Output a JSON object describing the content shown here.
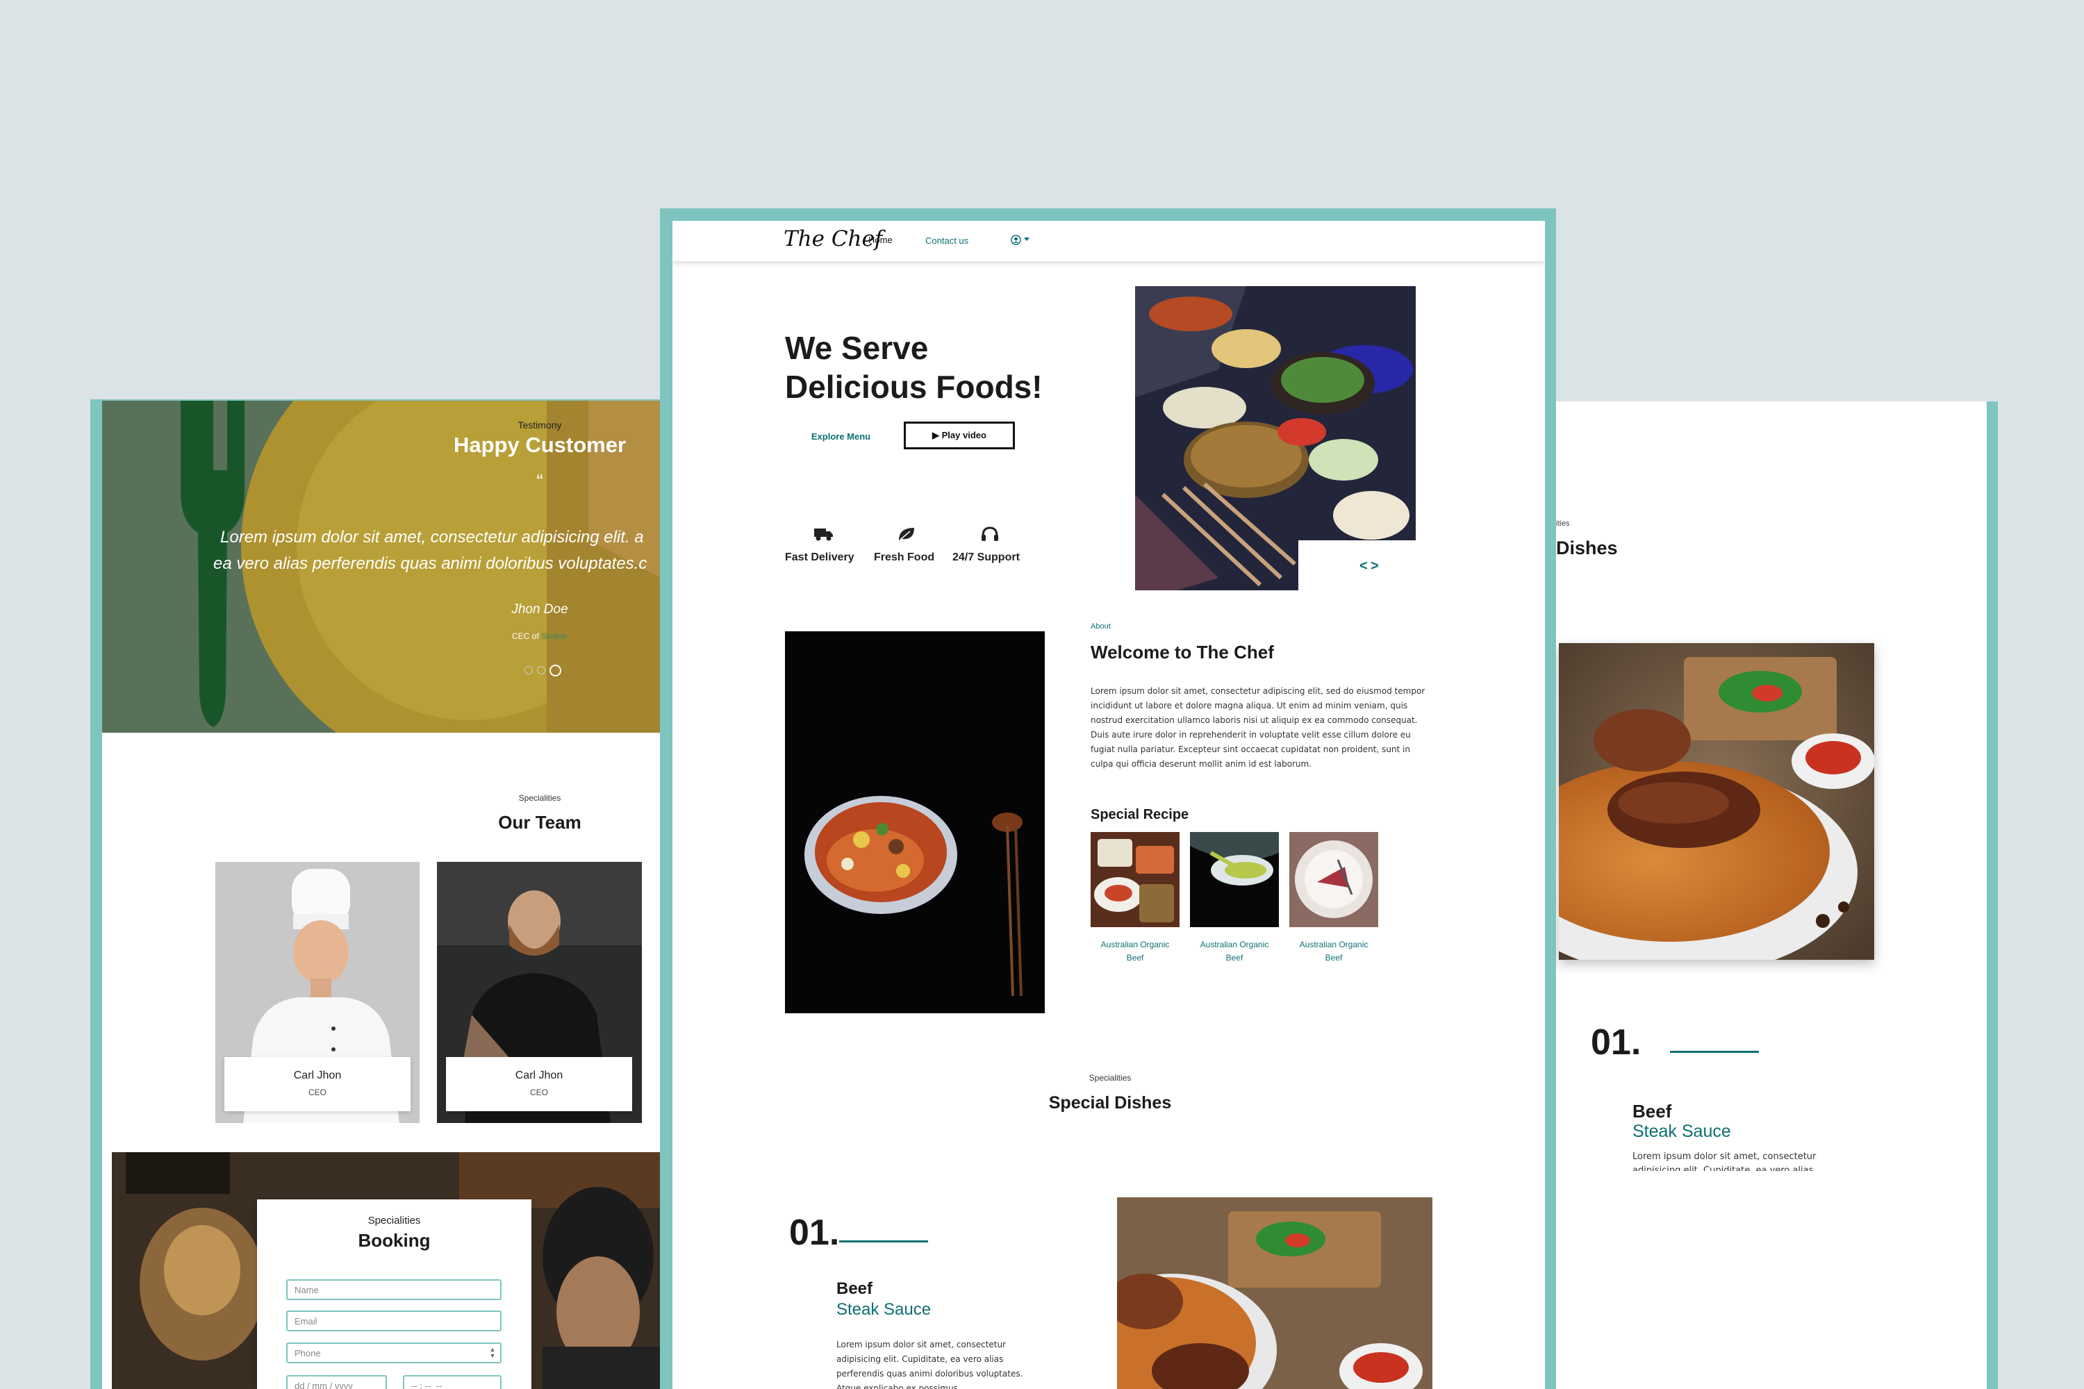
{
  "colors": {
    "background": "#dce3e6",
    "frame": "#7fc5bf",
    "accent": "#0e6f73",
    "dark": "#1b1b1b"
  },
  "left_page": {
    "testimony": {
      "eyebrow": "Testimony",
      "title": "Happy Customer",
      "quote_mark": "“",
      "quote_line1": "Lorem ipsum dolor sit amet, consectetur adipisicing elit. a",
      "quote_line2": "ea vero alias perferendis quas animi doloribus voluptates.c",
      "author": "Jhon Doe",
      "role_prefix": "CEC of",
      "role_company": "Sbaker"
    },
    "team": {
      "eyebrow": "Specialities",
      "title": "Our Team",
      "members": [
        {
          "name": "Carl Jhon",
          "role": "CEO"
        },
        {
          "name": "Carl Jhon",
          "role": "CEO"
        }
      ]
    },
    "booking": {
      "eyebrow": "Specialities",
      "title": "Booking",
      "name_placeholder": "Name",
      "email_placeholder": "Email",
      "phone_placeholder": "Phone",
      "date_placeholder": "dd / mm / yyyy",
      "time_placeholder": "-- : --  --"
    }
  },
  "center_page": {
    "nav": {
      "logo": "The Chef",
      "home": "Home",
      "contact": "Contact us",
      "user_icon": "user-circle-icon",
      "caret_icon": "caret-down-icon"
    },
    "hero": {
      "title_line1": "We Serve",
      "title_line2": "Delicious Foods!",
      "explore_label": "Explore Menu",
      "play_label": "▶ Play video",
      "features": [
        {
          "icon": "truck-icon",
          "label": "Fast Delivery"
        },
        {
          "icon": "leaf-icon",
          "label": "Fresh Food"
        },
        {
          "icon": "headset-icon",
          "label": "24/7 Support"
        }
      ],
      "carousel_prev": "<",
      "carousel_next": ">"
    },
    "about": {
      "eyebrow": "About",
      "title": "Welcome to The Chef",
      "body": "Lorem ipsum dolor sit amet, consectetur adipiscing elit, sed do eiusmod tempor incididunt ut labore et dolore magna aliqua. Ut enim ad minim veniam, quis nostrud exercitation ullamco laboris nisi ut aliquip ex ea commodo consequat. Duis aute irure dolor in reprehenderit in voluptate velit esse cillum dolore eu fugiat nulla pariatur. Excepteur sint occaecat cupidatat non proident, sunt in culpa qui officia deserunt mollit anim id est laborum.",
      "recipe_title": "Special Recipe",
      "recipes": [
        {
          "line1": "Australian Organic",
          "line2": "Beef"
        },
        {
          "line1": "Australian Organic",
          "line2": "Beef"
        },
        {
          "line1": "Australian Organic",
          "line2": "Beef"
        }
      ]
    },
    "dishes": {
      "eyebrow": "Specialities",
      "title": "Special Dishes",
      "number": "01.",
      "dish_title": "Beef",
      "dish_subtitle": "Steak Sauce",
      "dish_body": "Lorem ipsum dolor sit amet, consectetur adipisicing elit. Cupiditate, ea vero alias perferendis quas animi doloribus voluptates. Atque explicabo ex possimus"
    }
  },
  "right_page": {
    "eyebrow_partial": "ities",
    "title_partial": "Dishes",
    "number": "01.",
    "dish_title": "Beef",
    "dish_subtitle": "Steak Sauce",
    "dish_body": "Lorem ipsum dolor sit amet, consectetur adipisicing elit. Cupiditate, ea vero alias"
  }
}
